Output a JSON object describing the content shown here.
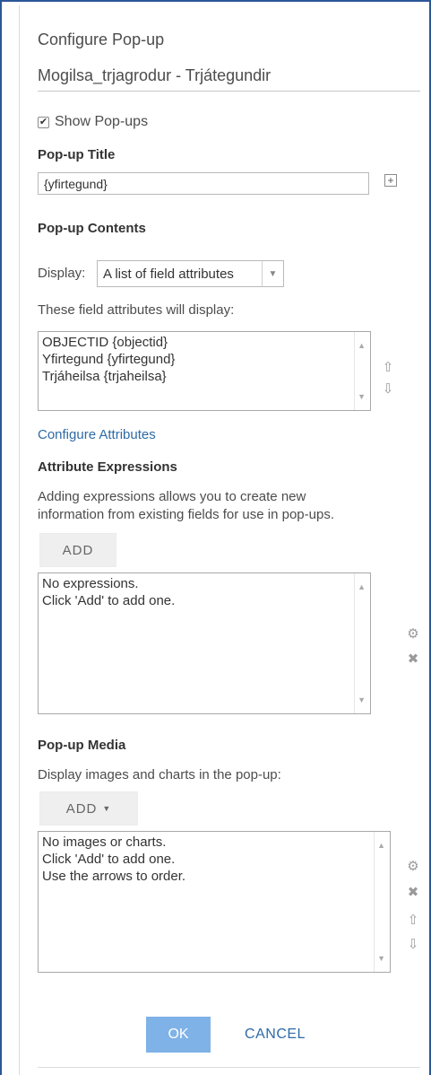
{
  "dialog": {
    "title": "Configure Pop-up",
    "layer_name": "Mogilsa_trjagrodur - Trjátegundir"
  },
  "show_popups": {
    "label": "Show Pop-ups",
    "checked": true
  },
  "popup_title": {
    "label": "Pop-up Title",
    "value": "{yfirtegund}"
  },
  "popup_contents": {
    "label": "Pop-up Contents",
    "display_label": "Display:",
    "display_value": "A list of field attributes",
    "attributes_caption": "These field attributes will display:",
    "attributes": [
      "OBJECTID {objectid}",
      "Yfirtegund {yfirtegund}",
      "Trjáheilsa {trjaheilsa}"
    ],
    "configure_link": "Configure Attributes"
  },
  "attribute_expressions": {
    "label": "Attribute Expressions",
    "description_line1": "Adding expressions allows you to create new",
    "description_line2": "information from existing fields for use in pop-ups.",
    "add_label": "ADD",
    "list": [
      "No expressions.",
      "Click 'Add' to add one."
    ]
  },
  "popup_media": {
    "label": "Pop-up Media",
    "description": "Display images and charts in the pop-up:",
    "add_label": "ADD",
    "list": [
      "No images or charts.",
      "Click 'Add' to add one.",
      "Use the arrows to order."
    ]
  },
  "footer": {
    "ok_label": "OK",
    "cancel_label": "CANCEL"
  },
  "colors": {
    "frame_border": "#2b5797",
    "link": "#2e6aa6",
    "ok_button": "#7fb2e6"
  }
}
